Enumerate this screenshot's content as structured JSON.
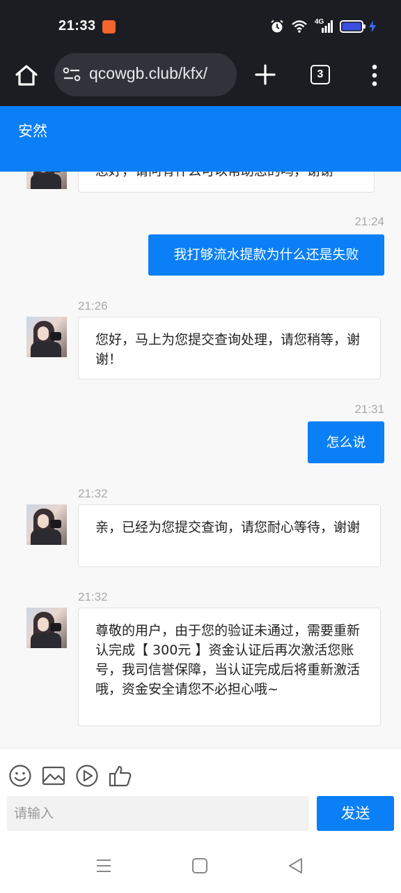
{
  "status_bar": {
    "time": "21:33",
    "network": "4G",
    "icons": [
      "app-badge-icon",
      "alarm-icon",
      "wifi-icon",
      "signal-icon",
      "battery-icon",
      "charging-icon"
    ]
  },
  "browser": {
    "url": "qcowgb.club/kfx/",
    "tab_count": "3",
    "icons": [
      "home-icon",
      "site-settings-icon",
      "new-tab-plus-icon",
      "tabs-icon",
      "more-menu-icon"
    ]
  },
  "chat": {
    "agent_name": "安然",
    "messages": [
      {
        "from": "agent",
        "text": "您好，请问有什么可以帮助您的吗，谢谢"
      },
      {
        "from": "user",
        "time": "21:24",
        "text": "我打够流水提款为什么还是失败"
      },
      {
        "from": "agent",
        "time": "21:26",
        "text": "您好，马上为您提交查询处理，请您稍等，谢谢！"
      },
      {
        "from": "user",
        "time": "21:31",
        "text": "怎么说"
      },
      {
        "from": "agent",
        "time": "21:32",
        "text": "亲，已经为您提交查询，请您耐心等待，谢谢"
      },
      {
        "from": "agent",
        "time": "21:32",
        "text": "尊敬的用户，由于您的验证未通过，需要重新认完成【 300元 】资金认证后再次激活您账号，我司信誉保障，当认证完成后将重新激活哦，资金安全请您不必担心哦~"
      }
    ]
  },
  "composer": {
    "placeholder": "请输入",
    "send_label": "发送",
    "tools": [
      "emoji-icon",
      "image-icon",
      "video-icon",
      "thumbs-up-icon"
    ]
  },
  "colors": {
    "accent": "#0a7ff6",
    "status_bar_bg": "#1b1d22",
    "battery": "#3d4de0"
  }
}
